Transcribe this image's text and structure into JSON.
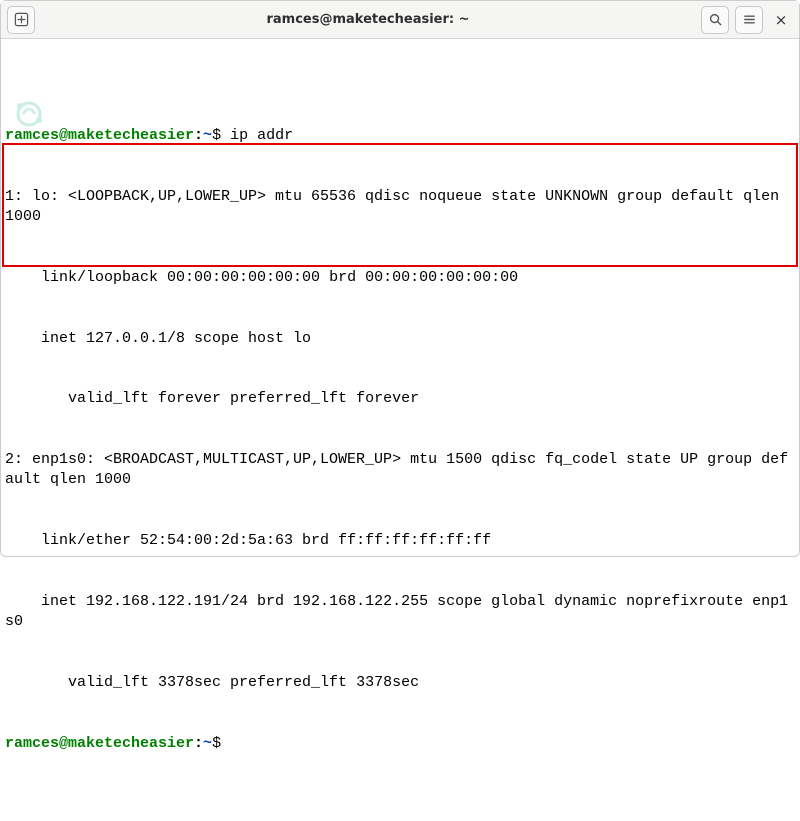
{
  "titlebar": {
    "title": "ramces@maketecheasier: ~"
  },
  "prompt": {
    "user_host": "ramces@maketecheasier",
    "sep": ":",
    "path": "~",
    "dollar": "$"
  },
  "command": " ip addr",
  "output": {
    "l1": "1: lo: <LOOPBACK,UP,LOWER_UP> mtu 65536 qdisc noqueue state UNKNOWN group default qlen 1000",
    "l2": "    link/loopback 00:00:00:00:00:00 brd 00:00:00:00:00:00",
    "l3": "    inet 127.0.0.1/8 scope host lo",
    "l4": "       valid_lft forever preferred_lft forever",
    "l5": "2: enp1s0: <BROADCAST,MULTICAST,UP,LOWER_UP> mtu 1500 qdisc fq_codel state UP group default qlen 1000",
    "l6": "    link/ether 52:54:00:2d:5a:63 brd ff:ff:ff:ff:ff:ff",
    "l7": "    inet 192.168.122.191/24 brd 192.168.122.255 scope global dynamic noprefixroute enp1s0",
    "l8": "       valid_lft 3378sec preferred_lft 3378sec"
  }
}
